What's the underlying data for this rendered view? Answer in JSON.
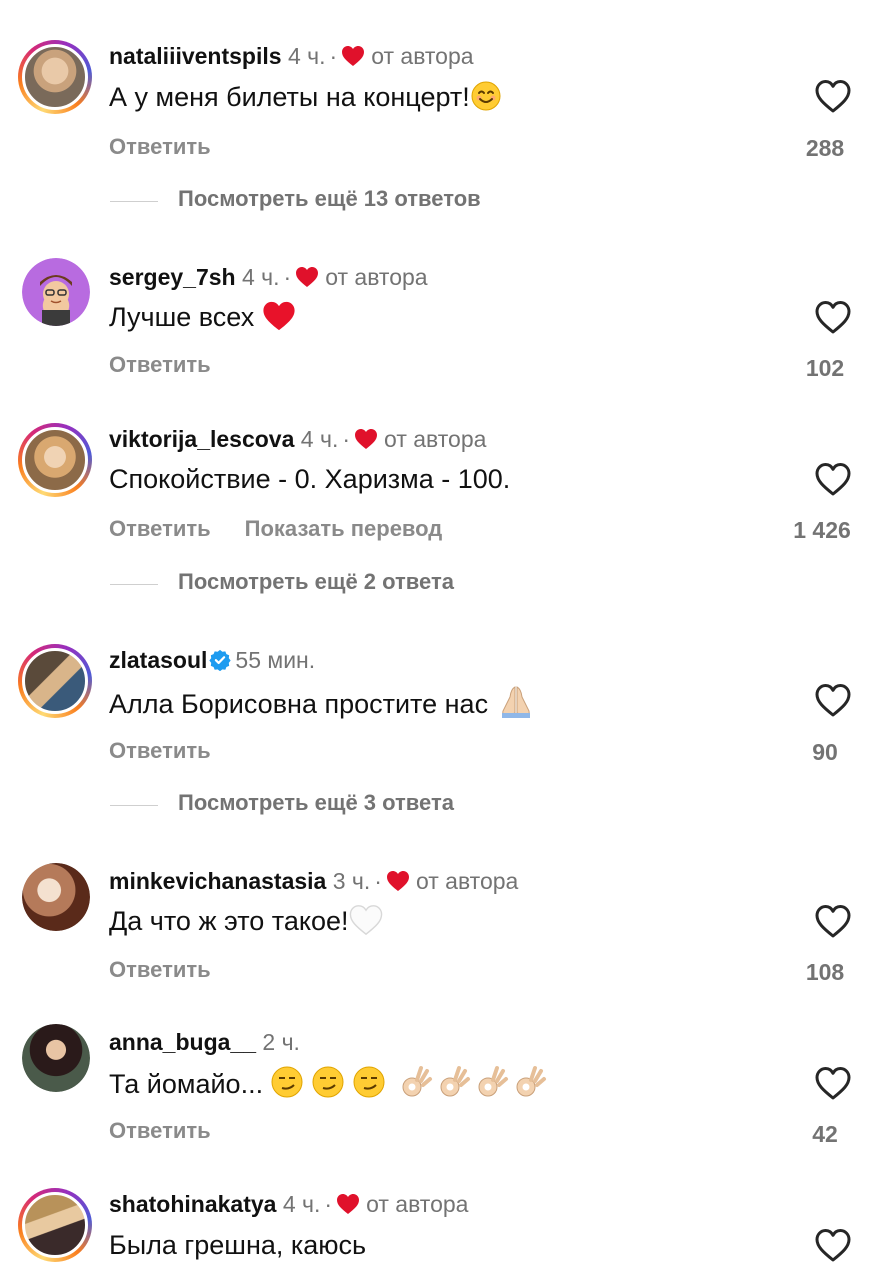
{
  "comments": [
    {
      "username": "nataliiiventspils",
      "time": "4 ч.",
      "separator": "·",
      "author_liked": "от автора",
      "text": "А у меня билеты на концерт!",
      "reply_label": "Ответить",
      "likes": "288",
      "more_replies": "Посмотреть ещё 13 ответов"
    },
    {
      "username": "sergey_7sh",
      "time": "4 ч.",
      "separator": "·",
      "author_liked": "от автора",
      "text": "Лучше всех",
      "reply_label": "Ответить",
      "likes": "102"
    },
    {
      "username": "viktorija_lescova",
      "time": "4 ч.",
      "separator": "·",
      "author_liked": "от автора",
      "text": "Спокойствие - 0. Харизма - 100.",
      "reply_label": "Ответить",
      "translate_label": "Показать перевод",
      "likes": "1 426",
      "more_replies": "Посмотреть ещё 2 ответа"
    },
    {
      "username": "zlatasoul",
      "verified": true,
      "time": "55 мин.",
      "text": "Алла Борисовна простите нас",
      "reply_label": "Ответить",
      "likes": "90",
      "more_replies": "Посмотреть ещё 3 ответа"
    },
    {
      "username": "minkevichanastasia",
      "time": "3 ч.",
      "separator": "·",
      "author_liked": "от автора",
      "text": "Да что ж это такое!",
      "reply_label": "Ответить",
      "likes": "108"
    },
    {
      "username": "anna_buga__",
      "time": "2 ч.",
      "text": "Та йомайо...",
      "reply_label": "Ответить",
      "likes": "42"
    },
    {
      "username": "shatohinakatya",
      "time": "4 ч.",
      "separator": "·",
      "author_liked": "от автора",
      "text": "Была грешна, каюсь"
    }
  ],
  "colors": {
    "heart_red": "#e0112b",
    "verified_blue": "#1d9bf0",
    "muted": "#737373"
  },
  "icons": {
    "like": "heart-outline-icon",
    "author_like": "heart-filled-icon",
    "verified": "verified-badge-icon"
  }
}
